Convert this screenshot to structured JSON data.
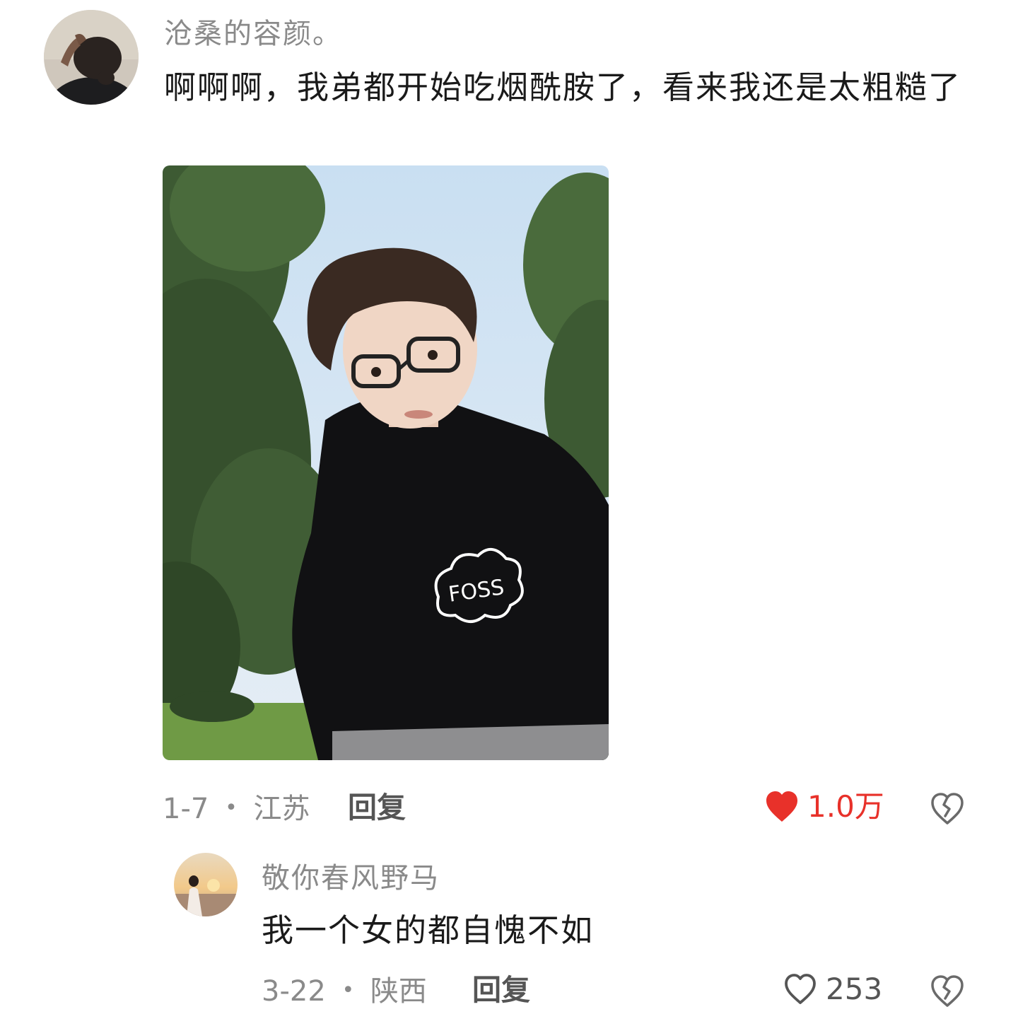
{
  "comment": {
    "username": "沧桑的容颜。",
    "text": "啊啊啊，我弟都开始吃烟酰胺了，看来我还是太粗糙了",
    "date": "1-7",
    "separator": "•",
    "location": "江苏",
    "reply_label": "回复",
    "like_count": "1.0万",
    "liked": true,
    "colors": {
      "like_active": "#e8312a"
    },
    "icons": {
      "like": "heart-filled-icon",
      "dislike": "broken-heart-icon"
    },
    "image": {
      "shirt_logo_text": "FOSS"
    }
  },
  "reply": {
    "username": "敬你春风野马",
    "text": "我一个女的都自愧不如",
    "date": "3-22",
    "separator": "•",
    "location": "陕西",
    "reply_label": "回复",
    "like_count": "253",
    "liked": false,
    "icons": {
      "like": "heart-outline-icon",
      "dislike": "broken-heart-icon"
    }
  }
}
